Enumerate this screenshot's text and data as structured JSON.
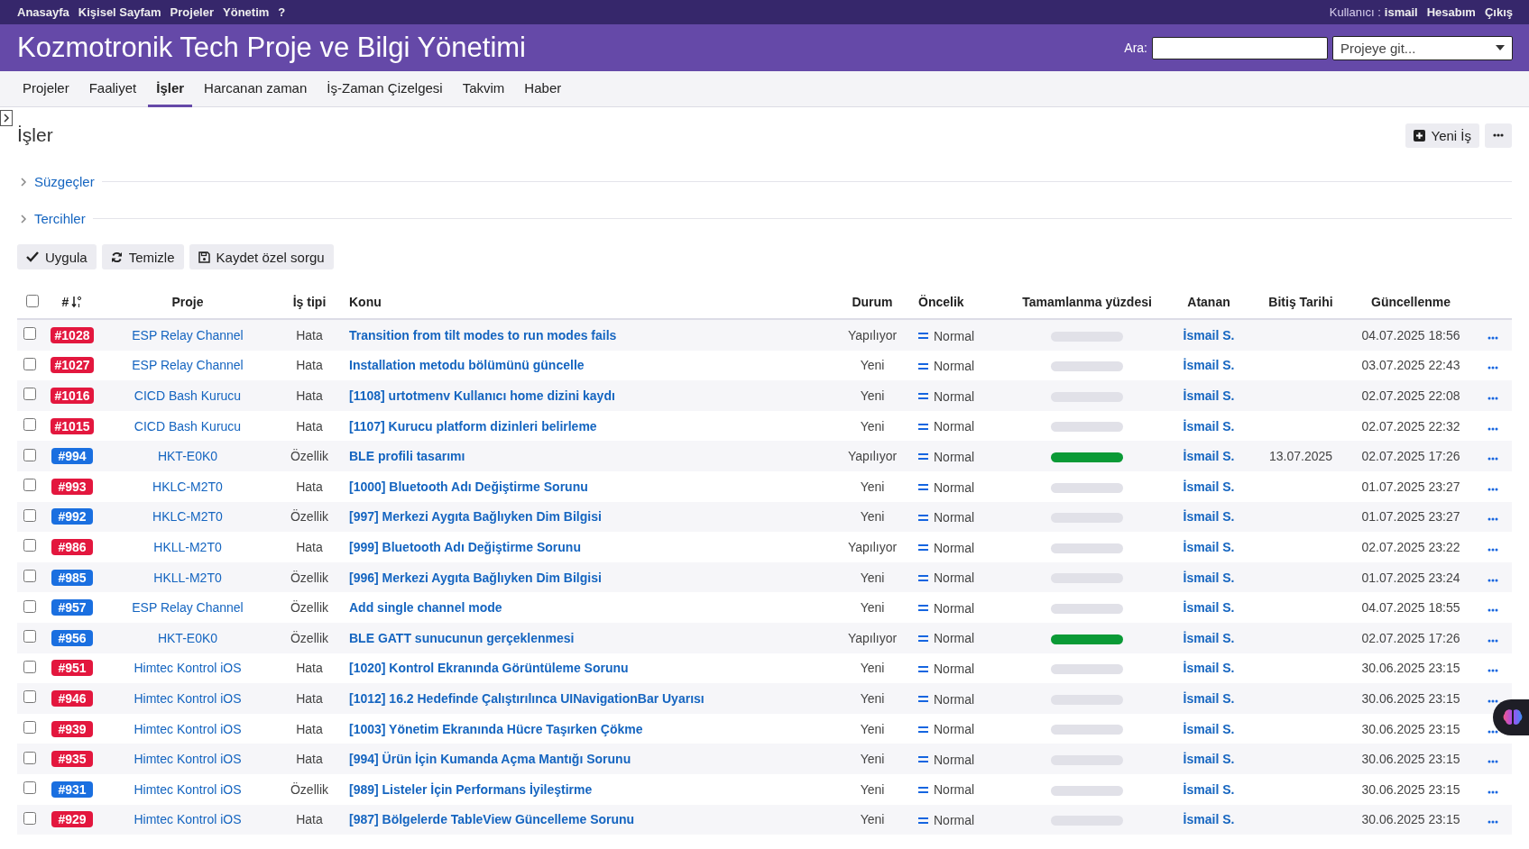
{
  "top_menu": [
    "Anasayfa",
    "Kişisel Sayfam",
    "Projeler",
    "Yönetim",
    "?"
  ],
  "account": {
    "label": "Kullanıcı :",
    "user": "ismail",
    "links": [
      "Hesabım",
      "Çıkış"
    ]
  },
  "header": {
    "title": "Kozmotronik Tech Proje ve Bilgi Yönetimi",
    "search_label": "Ara:",
    "jump_placeholder": "Projeye git..."
  },
  "tabs": [
    {
      "label": "Projeler",
      "selected": false
    },
    {
      "label": "Faaliyet",
      "selected": false
    },
    {
      "label": "İşler",
      "selected": true
    },
    {
      "label": "Harcanan zaman",
      "selected": false
    },
    {
      "label": "İş-Zaman Çizelgesi",
      "selected": false
    },
    {
      "label": "Takvim",
      "selected": false
    },
    {
      "label": "Haber",
      "selected": false
    }
  ],
  "page_title": "İşler",
  "new_button": "Yeni İş",
  "sections": [
    {
      "label": "Süzgeçler",
      "expanded": false
    },
    {
      "label": "Tercihler",
      "expanded": false
    }
  ],
  "actions": [
    {
      "label": "Uygula",
      "kind": "apply"
    },
    {
      "label": "Temizle",
      "kind": "clear"
    },
    {
      "label": "Kaydet özel sorgu",
      "kind": "save"
    }
  ],
  "table": {
    "all_checked": false,
    "columns": [
      "#",
      "Proje",
      "İş tipi",
      "Konu",
      "Durum",
      "Öncelik",
      "Tamamlanma yüzdesi",
      "Atanan",
      "Bitiş Tarihi",
      "Güncellenme"
    ],
    "rows": [
      {
        "checked": false,
        "id": "#1028",
        "color": "#e3173e",
        "project": "ESP Relay Channel",
        "type": "Hata",
        "subject": "Transition from tilt modes to run modes fails",
        "status": "Yapılıyor",
        "priority": "Normal",
        "level": 0,
        "assignee": "İsmail S.",
        "updated": "04.07.2025 18:56"
      },
      {
        "checked": false,
        "id": "#1027",
        "color": "#e3173e",
        "project": "ESP Relay Channel",
        "type": "Hata",
        "subject": "Installation metodu bölümünü güncelle",
        "status": "Yeni",
        "priority": "Normal",
        "level": 0,
        "assignee": "İsmail S.",
        "updated": "03.07.2025 22:43"
      },
      {
        "checked": false,
        "id": "#1016",
        "color": "#e3173e",
        "project": "CICD Bash Kurucu",
        "type": "Hata",
        "subject": "[1108] urtotmenv Kullanıcı home dizini kaydı",
        "status": "Yeni",
        "priority": "Normal",
        "level": 0,
        "assignee": "İsmail S.",
        "updated": "02.07.2025 22:08"
      },
      {
        "checked": false,
        "id": "#1015",
        "color": "#e3173e",
        "project": "CICD Bash Kurucu",
        "type": "Hata",
        "subject": "[1107] Kurucu platform dizinleri belirleme",
        "status": "Yeni",
        "priority": "Normal",
        "level": 0,
        "assignee": "İsmail S.",
        "updated": "02.07.2025 22:32"
      },
      {
        "checked": false,
        "id": "#994",
        "color": "#1a6fe0",
        "project": "HKT-E0K0",
        "type": "Özellik",
        "subject": "BLE profili tasarımı",
        "status": "Yapılıyor",
        "priority": "Normal",
        "level": 1,
        "assignee": "İsmail S.",
        "due": "13.07.2025",
        "updated": "02.07.2025 17:26"
      },
      {
        "checked": false,
        "id": "#993",
        "color": "#e3173e",
        "project": "HKLC-M2T0",
        "type": "Hata",
        "subject": "[1000] Bluetooth Adı Değiştirme Sorunu",
        "status": "Yeni",
        "priority": "Normal",
        "level": 0,
        "assignee": "İsmail S.",
        "updated": "01.07.2025 23:27"
      },
      {
        "checked": false,
        "id": "#992",
        "color": "#1a6fe0",
        "project": "HKLC-M2T0",
        "type": "Özellik",
        "subject": "[997] Merkezi Aygıta Bağlıyken Dim Bilgisi",
        "status": "Yeni",
        "priority": "Normal",
        "level": 0,
        "assignee": "İsmail S.",
        "updated": "01.07.2025 23:27"
      },
      {
        "checked": false,
        "id": "#986",
        "color": "#e3173e",
        "project": "HKLL-M2T0",
        "type": "Hata",
        "subject": "[999] Bluetooth Adı Değiştirme Sorunu",
        "status": "Yapılıyor",
        "priority": "Normal",
        "level": 0,
        "assignee": "İsmail S.",
        "updated": "02.07.2025 23:22"
      },
      {
        "checked": false,
        "id": "#985",
        "color": "#1a6fe0",
        "project": "HKLL-M2T0",
        "type": "Özellik",
        "subject": "[996] Merkezi Aygıta Bağlıyken Dim Bilgisi",
        "status": "Yeni",
        "priority": "Normal",
        "level": 0,
        "assignee": "İsmail S.",
        "updated": "01.07.2025 23:24"
      },
      {
        "checked": false,
        "id": "#957",
        "color": "#1a6fe0",
        "project": "ESP Relay Channel",
        "type": "Özellik",
        "subject": "Add single channel mode",
        "status": "Yeni",
        "priority": "Normal",
        "level": 0,
        "assignee": "İsmail S.",
        "updated": "04.07.2025 18:55"
      },
      {
        "checked": false,
        "id": "#956",
        "color": "#1a6fe0",
        "project": "HKT-E0K0",
        "type": "Özellik",
        "subject": "BLE GATT sunucunun gerçeklenmesi",
        "status": "Yapılıyor",
        "priority": "Normal",
        "level": 1,
        "assignee": "İsmail S.",
        "updated": "02.07.2025 17:26"
      },
      {
        "checked": false,
        "id": "#951",
        "color": "#e3173e",
        "project": "Himtec Kontrol iOS",
        "type": "Hata",
        "subject": "[1020] Kontrol Ekranında Görüntüleme Sorunu",
        "status": "Yeni",
        "priority": "Normal",
        "level": 0,
        "assignee": "İsmail S.",
        "updated": "30.06.2025 23:15"
      },
      {
        "checked": false,
        "id": "#946",
        "color": "#e3173e",
        "project": "Himtec Kontrol iOS",
        "type": "Hata",
        "subject": "[1012] 16.2 Hedefinde Çalıştırılınca UINavigationBar Uyarısı",
        "status": "Yeni",
        "priority": "Normal",
        "level": 0,
        "assignee": "İsmail S.",
        "updated": "30.06.2025 23:15"
      },
      {
        "checked": false,
        "id": "#939",
        "color": "#e3173e",
        "project": "Himtec Kontrol iOS",
        "type": "Hata",
        "subject": "[1003] Yönetim Ekranında Hücre Taşırken Çökme",
        "status": "Yeni",
        "priority": "Normal",
        "level": 0,
        "assignee": "İsmail S.",
        "updated": "30.06.2025 23:15"
      },
      {
        "checked": false,
        "id": "#935",
        "color": "#e3173e",
        "project": "Himtec Kontrol iOS",
        "type": "Hata",
        "subject": "[994] Ürün İçin Kumanda Açma Mantığı Sorunu",
        "status": "Yeni",
        "priority": "Normal",
        "level": 0,
        "assignee": "İsmail S.",
        "updated": "30.06.2025 23:15"
      },
      {
        "checked": false,
        "id": "#931",
        "color": "#1a6fe0",
        "project": "Himtec Kontrol iOS",
        "type": "Özellik",
        "subject": "[989] Listeler İçin Performans İyileştirme",
        "status": "Yeni",
        "priority": "Normal",
        "level": 0,
        "assignee": "İsmail S.",
        "updated": "30.06.2025 23:15"
      },
      {
        "checked": false,
        "id": "#929",
        "color": "#e3173e",
        "project": "Himtec Kontrol iOS",
        "type": "Hata",
        "subject": "[987] Bölgelerde TableView Güncelleme Sorunu",
        "status": "Yeni",
        "priority": "Normal",
        "level": 0,
        "assignee": "İsmail S.",
        "updated": "30.06.2025 23:15"
      }
    ]
  }
}
